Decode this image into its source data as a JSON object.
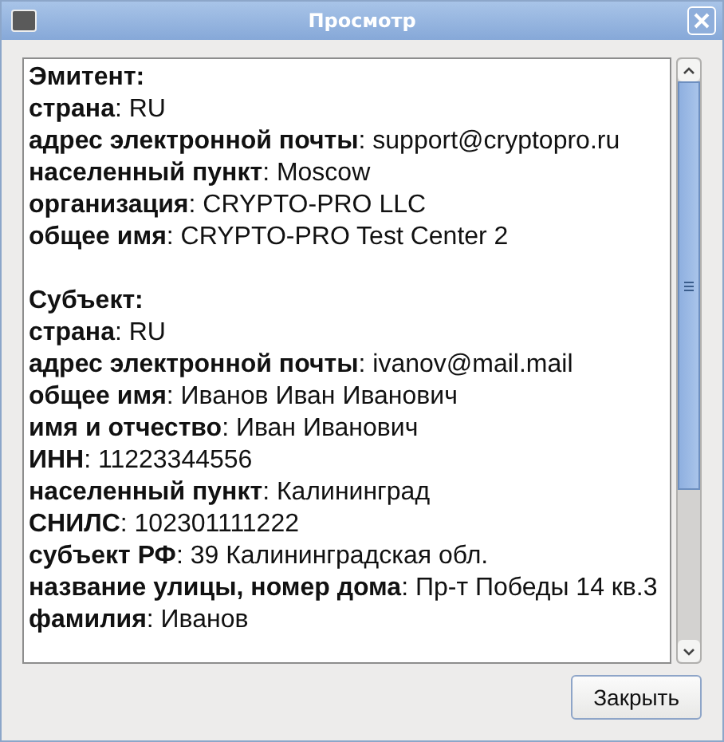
{
  "window": {
    "title": "Просмотр"
  },
  "sections": [
    {
      "heading": "Эмитент:",
      "fields": [
        "**страна**: RU",
        "**адрес электронной почты**: support@cryptopro.ru",
        "**населенный пункт**: Moscow",
        "**организация**: CRYPTO-PRO LLC",
        "**общее имя**: CRYPTO-PRO Test Center 2"
      ]
    },
    {
      "heading": "Субъект:",
      "fields": [
        "**страна**: RU",
        "**адрес электронной почты**: ivanov@mail.mail",
        "**общее имя**: Иванов Иван Иванович",
        "**имя и отчество**: Иван Иванович",
        "**ИНН**: 11223344556",
        "**населенный пункт**: Калининград",
        "**СНИЛС**: 102301111222",
        "**субъект РФ**: 39 Калининградская обл.",
        "**название улицы, номер дома**: Пр-т Победы 14 кв.3",
        "**фамилия**: Иванов"
      ]
    }
  ],
  "buttons": [
    "Закрыть"
  ]
}
